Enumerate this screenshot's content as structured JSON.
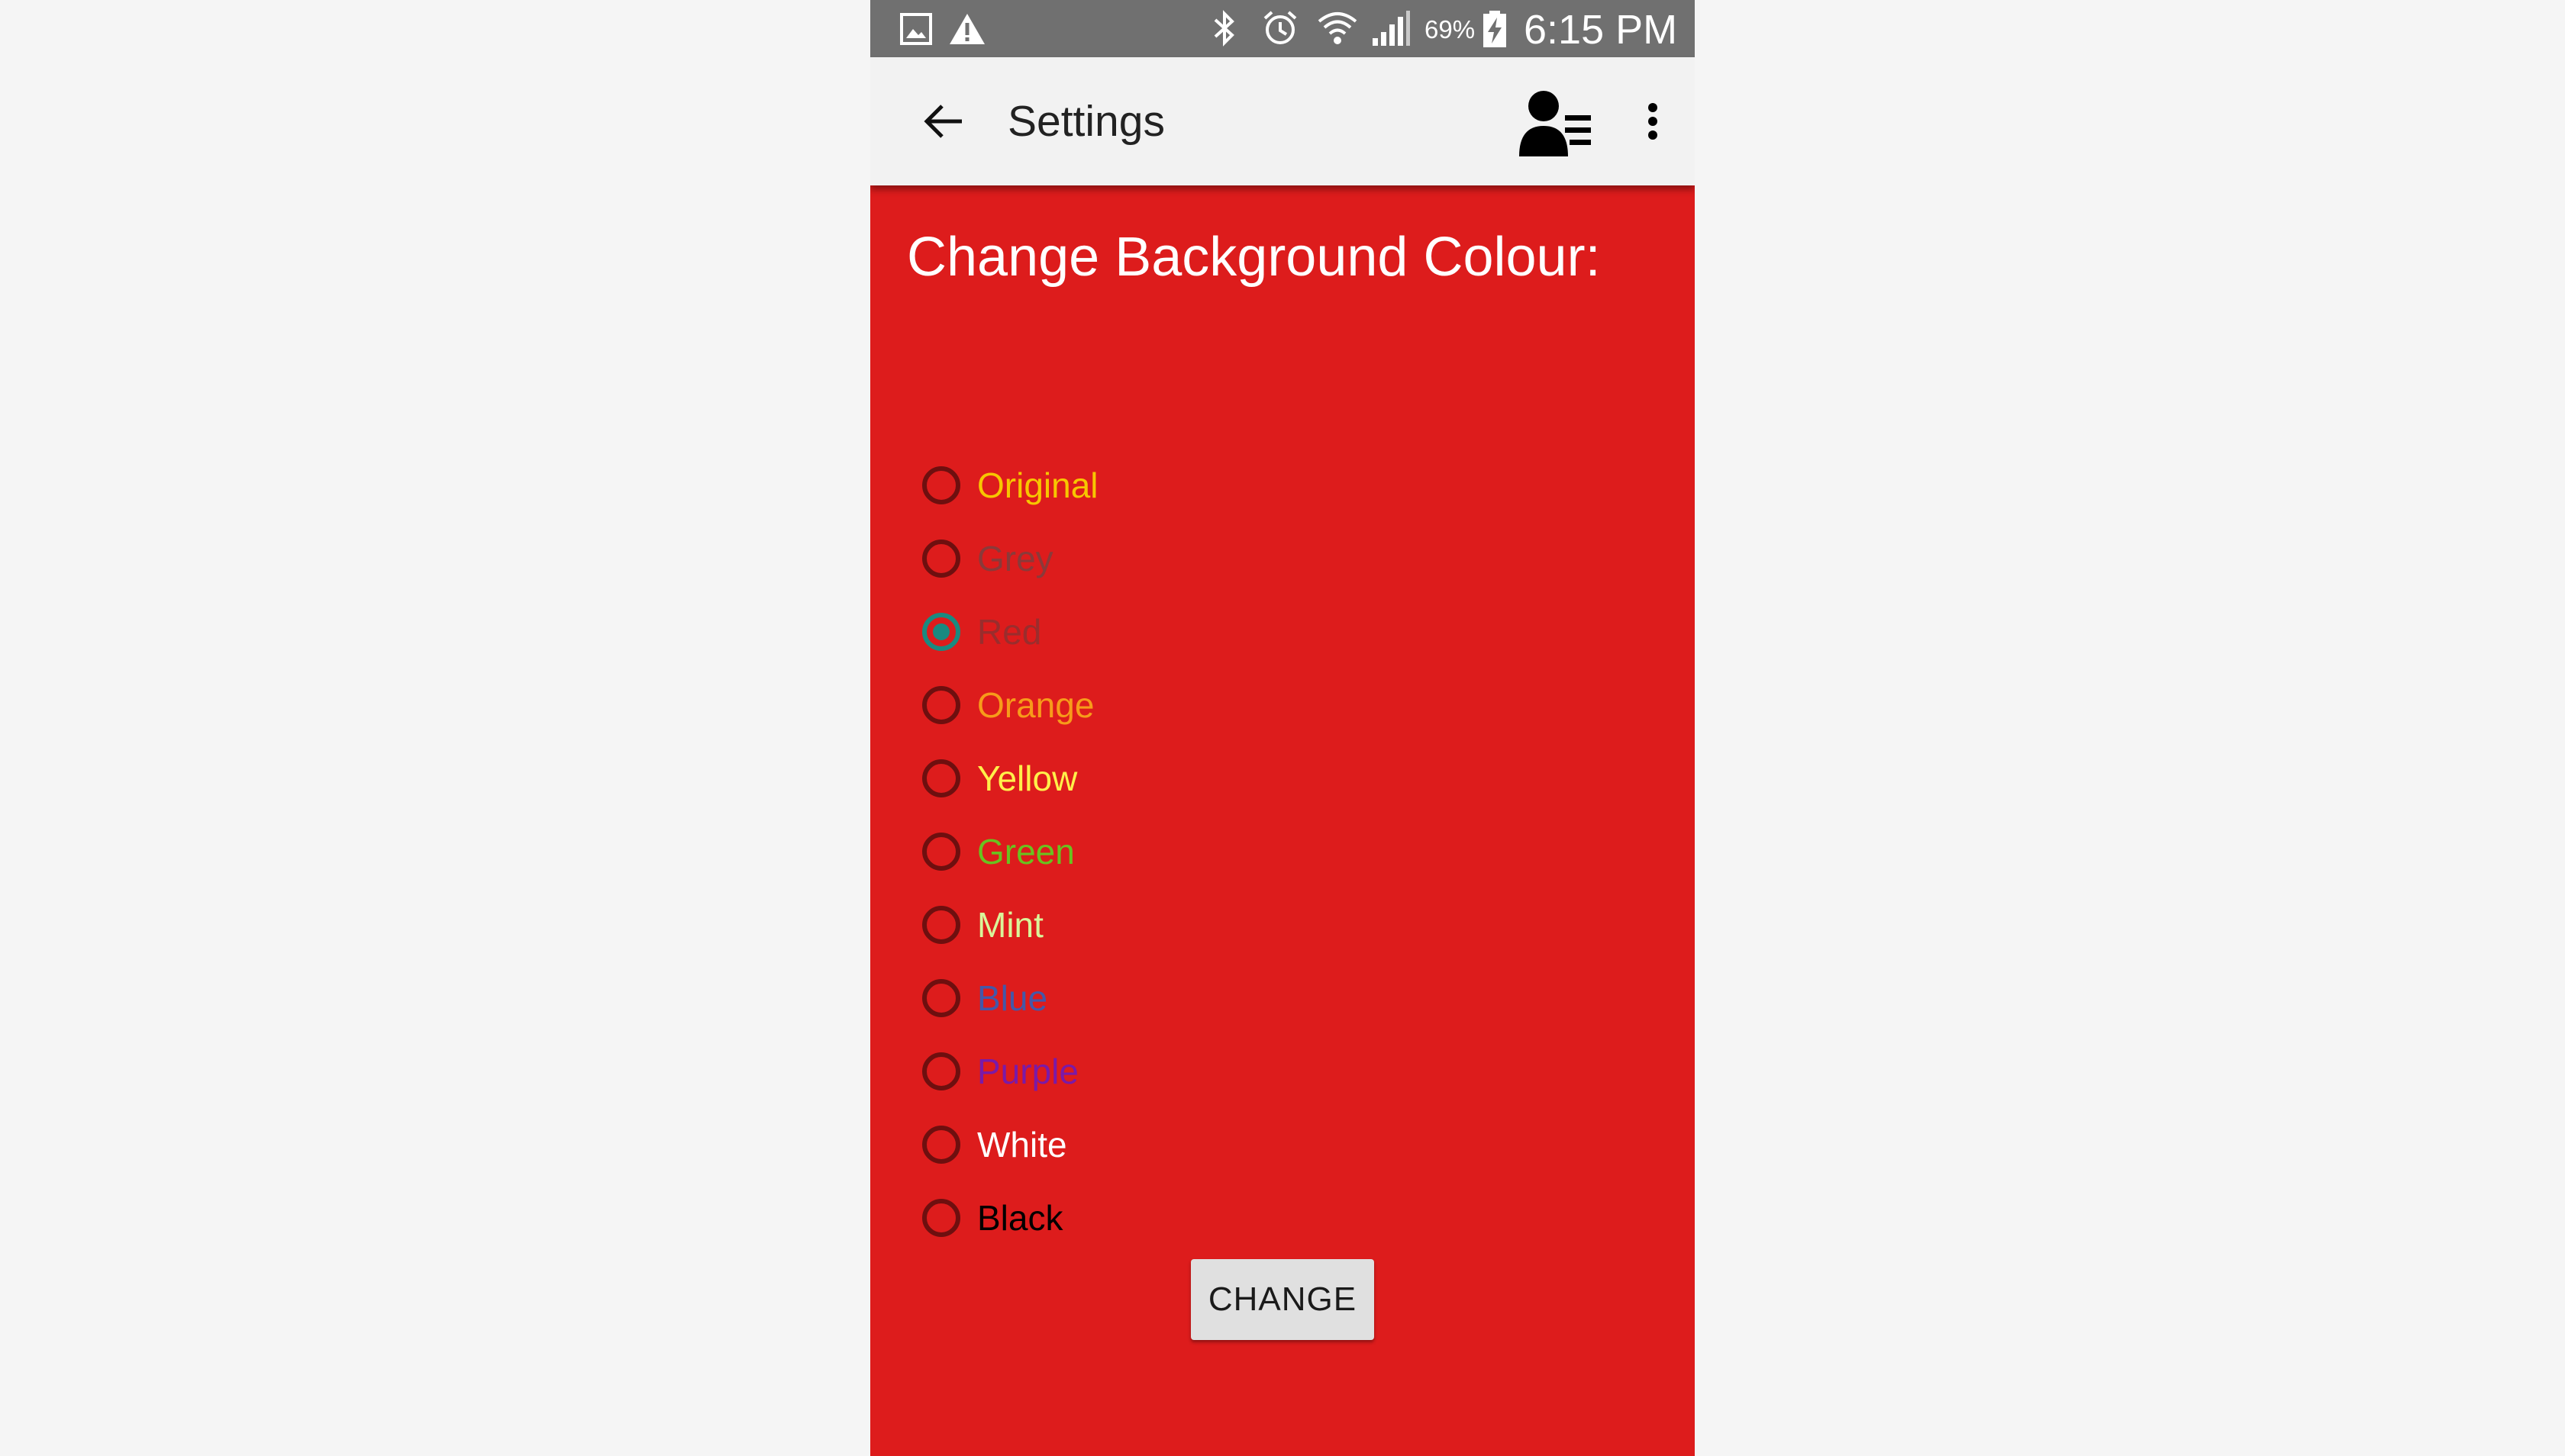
{
  "status_bar": {
    "battery": "69%",
    "time": "6:15 PM",
    "icons": [
      "gallery-icon",
      "warning-icon",
      "bluetooth-icon",
      "alarm-icon",
      "wifi-icon",
      "signal-icon",
      "battery-charging-icon"
    ]
  },
  "app_bar": {
    "title": "Settings",
    "back_icon": "arrow-left-icon",
    "profile_icon": "user-list-icon",
    "overflow_icon": "more-vert-icon"
  },
  "content": {
    "heading": "Change Background Colour:",
    "options": [
      {
        "label": "Original",
        "color": "#f7c600",
        "checked": false
      },
      {
        "label": "Grey",
        "color": "#8a3a3a",
        "checked": false
      },
      {
        "label": "Red",
        "color": "#9a2d2d",
        "checked": true
      },
      {
        "label": "Orange",
        "color": "#f79b1a",
        "checked": false
      },
      {
        "label": "Yellow",
        "color": "#fff04a",
        "checked": false
      },
      {
        "label": "Green",
        "color": "#69c21f",
        "checked": false
      },
      {
        "label": "Mint",
        "color": "#d9f59a",
        "checked": false
      },
      {
        "label": "Blue",
        "color": "#4458a8",
        "checked": false
      },
      {
        "label": "Purple",
        "color": "#7a1aa8",
        "checked": false
      },
      {
        "label": "White",
        "color": "#ffffff",
        "checked": false
      },
      {
        "label": "Black",
        "color": "#000000",
        "checked": false
      }
    ],
    "button_label": "CHANGE"
  },
  "colors": {
    "background": "#dd1c1c",
    "app_bar": "#f2f2f2",
    "status_bar": "#707070",
    "radio_accent": "#1a8a80"
  }
}
